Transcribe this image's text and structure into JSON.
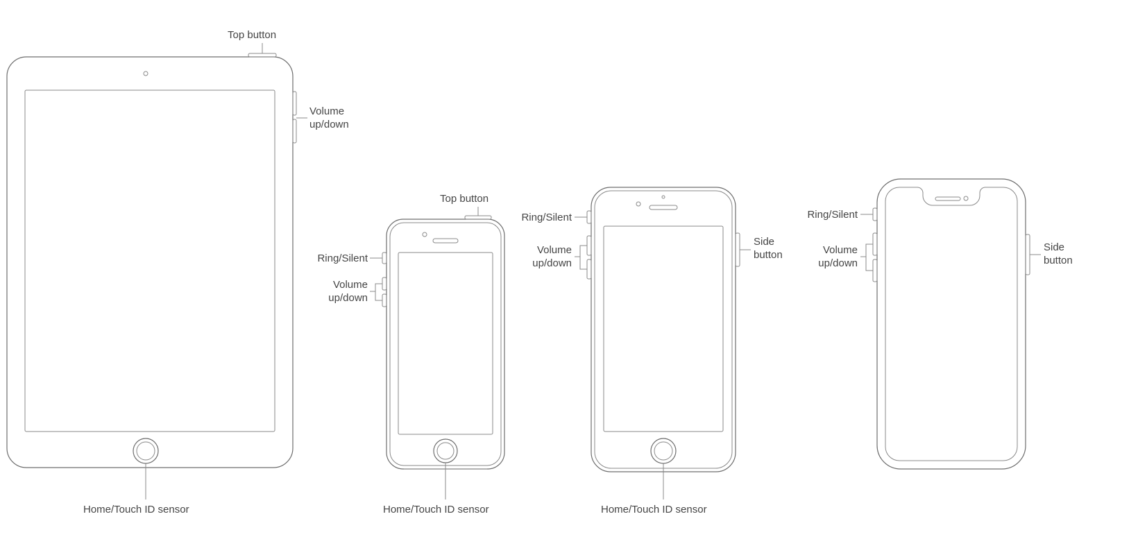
{
  "labels": {
    "top_button": "Top button",
    "volume": "Volume\nup/down",
    "ring_silent": "Ring/Silent",
    "side_button": "Side\nbutton",
    "home": "Home/Touch ID sensor"
  },
  "devices": {
    "ipad": {
      "top_button": true,
      "volume_side": "right",
      "home": true
    },
    "iphone_se": {
      "top_button": true,
      "ring_silent": true,
      "volume_side": "left",
      "home": true
    },
    "iphone_8": {
      "ring_silent": true,
      "volume_side": "left",
      "side_button": true,
      "home": true
    },
    "iphone_x": {
      "ring_silent": true,
      "volume_side": "left",
      "side_button": true,
      "home": false
    }
  }
}
